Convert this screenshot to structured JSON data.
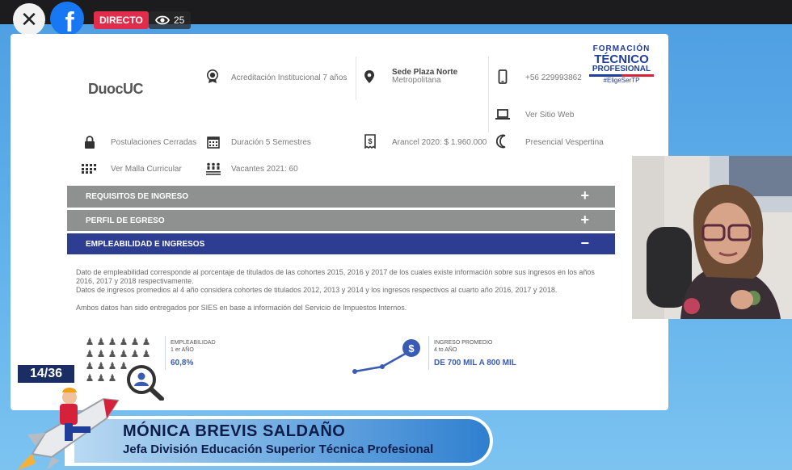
{
  "live": {
    "close_label": "✕",
    "live_label": "DIRECTO",
    "viewers": "25"
  },
  "slide": {
    "brand": "DuocUC",
    "accreditation": "Acreditación Institucional 7 años",
    "sede_title": "Sede Plaza Norte",
    "sede_sub": "Metropolitana",
    "phone": "+56 229993862",
    "website": "Ver Sitio Web",
    "postulaciones": "Postulaciones Cerradas",
    "duracion": "Duración 5 Semestres",
    "arancel": "Arancel 2020: $ 1.960.000",
    "jornada": "Presencial Vespertina",
    "malla": "Ver Malla Curricular",
    "vacantes": "Vacantes 2021: 60",
    "ftp": {
      "line1": "FORMACIÓN",
      "line2": "TÉCNICO",
      "line3": "PROFESIONAL",
      "hashtag": "#EligeSerTP"
    },
    "accordion": [
      {
        "label": "REQUISITOS DE INGRESO",
        "sign": "+"
      },
      {
        "label": "PERFIL DE EGRESO",
        "sign": "+"
      },
      {
        "label": "EMPLEABILIDAD E INGRESOS",
        "sign": "−"
      }
    ],
    "para1": "Dato de empleabilidad corresponde al porcentaje de titulados de las cohortes 2015, 2016 y 2017 de los cuales existe información sobre sus ingresos en los años 2016, 2017 y 2018 respectivamente.",
    "para2": "Datos de ingresos promedios al 4 año considera cohortes de titulados 2012, 2013 y 2014 y los ingresos respectivos al cuarto año 2016, 2017 y 2018.",
    "para3": "Ambos datos han sido entregados por SIES en base a información del Servicio de Impuestos Internos.",
    "empleabilidad": {
      "label1": "EMPLEABILIDAD",
      "label2": "1 er AÑO",
      "value": "60,8%"
    },
    "ingreso": {
      "label1": "INGRESO PROMEDIO",
      "label2": "4 to AÑO",
      "value": "DE 700 MIL A 800 MIL"
    }
  },
  "lower_third": {
    "counter": "14/36",
    "name": "MÓNICA BREVIS SALDAÑO",
    "role": "Jefa División Educación Superior Técnica Profesional"
  },
  "colors": {
    "accent_blue": "#2d3e92",
    "accordion_gray": "#8f9190",
    "live_red": "#e02d4c",
    "facebook_blue": "#1877f2"
  },
  "icons": [
    "close-icon",
    "facebook-icon",
    "eye-icon",
    "award-icon",
    "location-icon",
    "phone-icon",
    "laptop-icon",
    "lock-icon",
    "calendar-icon",
    "receipt-icon",
    "moon-icon",
    "grid-icon",
    "people-icon",
    "search-person-icon",
    "dollar-icon",
    "rocket-mascot-icon"
  ]
}
